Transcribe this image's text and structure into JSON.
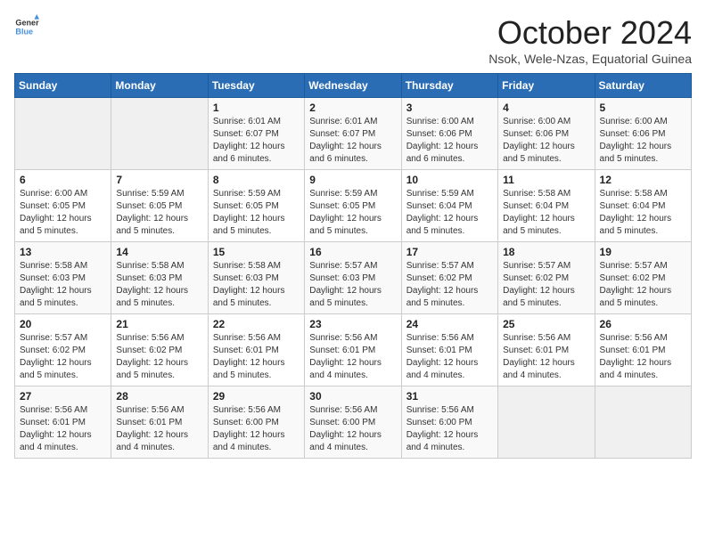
{
  "logo": {
    "line1": "General",
    "line2": "Blue"
  },
  "title": "October 2024",
  "subtitle": "Nsok, Wele-Nzas, Equatorial Guinea",
  "days_of_week": [
    "Sunday",
    "Monday",
    "Tuesday",
    "Wednesday",
    "Thursday",
    "Friday",
    "Saturday"
  ],
  "weeks": [
    [
      {
        "day": "",
        "info": ""
      },
      {
        "day": "",
        "info": ""
      },
      {
        "day": "1",
        "info": "Sunrise: 6:01 AM\nSunset: 6:07 PM\nDaylight: 12 hours and 6 minutes."
      },
      {
        "day": "2",
        "info": "Sunrise: 6:01 AM\nSunset: 6:07 PM\nDaylight: 12 hours and 6 minutes."
      },
      {
        "day": "3",
        "info": "Sunrise: 6:00 AM\nSunset: 6:06 PM\nDaylight: 12 hours and 6 minutes."
      },
      {
        "day": "4",
        "info": "Sunrise: 6:00 AM\nSunset: 6:06 PM\nDaylight: 12 hours and 5 minutes."
      },
      {
        "day": "5",
        "info": "Sunrise: 6:00 AM\nSunset: 6:06 PM\nDaylight: 12 hours and 5 minutes."
      }
    ],
    [
      {
        "day": "6",
        "info": "Sunrise: 6:00 AM\nSunset: 6:05 PM\nDaylight: 12 hours and 5 minutes."
      },
      {
        "day": "7",
        "info": "Sunrise: 5:59 AM\nSunset: 6:05 PM\nDaylight: 12 hours and 5 minutes."
      },
      {
        "day": "8",
        "info": "Sunrise: 5:59 AM\nSunset: 6:05 PM\nDaylight: 12 hours and 5 minutes."
      },
      {
        "day": "9",
        "info": "Sunrise: 5:59 AM\nSunset: 6:05 PM\nDaylight: 12 hours and 5 minutes."
      },
      {
        "day": "10",
        "info": "Sunrise: 5:59 AM\nSunset: 6:04 PM\nDaylight: 12 hours and 5 minutes."
      },
      {
        "day": "11",
        "info": "Sunrise: 5:58 AM\nSunset: 6:04 PM\nDaylight: 12 hours and 5 minutes."
      },
      {
        "day": "12",
        "info": "Sunrise: 5:58 AM\nSunset: 6:04 PM\nDaylight: 12 hours and 5 minutes."
      }
    ],
    [
      {
        "day": "13",
        "info": "Sunrise: 5:58 AM\nSunset: 6:03 PM\nDaylight: 12 hours and 5 minutes."
      },
      {
        "day": "14",
        "info": "Sunrise: 5:58 AM\nSunset: 6:03 PM\nDaylight: 12 hours and 5 minutes."
      },
      {
        "day": "15",
        "info": "Sunrise: 5:58 AM\nSunset: 6:03 PM\nDaylight: 12 hours and 5 minutes."
      },
      {
        "day": "16",
        "info": "Sunrise: 5:57 AM\nSunset: 6:03 PM\nDaylight: 12 hours and 5 minutes."
      },
      {
        "day": "17",
        "info": "Sunrise: 5:57 AM\nSunset: 6:02 PM\nDaylight: 12 hours and 5 minutes."
      },
      {
        "day": "18",
        "info": "Sunrise: 5:57 AM\nSunset: 6:02 PM\nDaylight: 12 hours and 5 minutes."
      },
      {
        "day": "19",
        "info": "Sunrise: 5:57 AM\nSunset: 6:02 PM\nDaylight: 12 hours and 5 minutes."
      }
    ],
    [
      {
        "day": "20",
        "info": "Sunrise: 5:57 AM\nSunset: 6:02 PM\nDaylight: 12 hours and 5 minutes."
      },
      {
        "day": "21",
        "info": "Sunrise: 5:56 AM\nSunset: 6:02 PM\nDaylight: 12 hours and 5 minutes."
      },
      {
        "day": "22",
        "info": "Sunrise: 5:56 AM\nSunset: 6:01 PM\nDaylight: 12 hours and 5 minutes."
      },
      {
        "day": "23",
        "info": "Sunrise: 5:56 AM\nSunset: 6:01 PM\nDaylight: 12 hours and 4 minutes."
      },
      {
        "day": "24",
        "info": "Sunrise: 5:56 AM\nSunset: 6:01 PM\nDaylight: 12 hours and 4 minutes."
      },
      {
        "day": "25",
        "info": "Sunrise: 5:56 AM\nSunset: 6:01 PM\nDaylight: 12 hours and 4 minutes."
      },
      {
        "day": "26",
        "info": "Sunrise: 5:56 AM\nSunset: 6:01 PM\nDaylight: 12 hours and 4 minutes."
      }
    ],
    [
      {
        "day": "27",
        "info": "Sunrise: 5:56 AM\nSunset: 6:01 PM\nDaylight: 12 hours and 4 minutes."
      },
      {
        "day": "28",
        "info": "Sunrise: 5:56 AM\nSunset: 6:01 PM\nDaylight: 12 hours and 4 minutes."
      },
      {
        "day": "29",
        "info": "Sunrise: 5:56 AM\nSunset: 6:00 PM\nDaylight: 12 hours and 4 minutes."
      },
      {
        "day": "30",
        "info": "Sunrise: 5:56 AM\nSunset: 6:00 PM\nDaylight: 12 hours and 4 minutes."
      },
      {
        "day": "31",
        "info": "Sunrise: 5:56 AM\nSunset: 6:00 PM\nDaylight: 12 hours and 4 minutes."
      },
      {
        "day": "",
        "info": ""
      },
      {
        "day": "",
        "info": ""
      }
    ]
  ]
}
